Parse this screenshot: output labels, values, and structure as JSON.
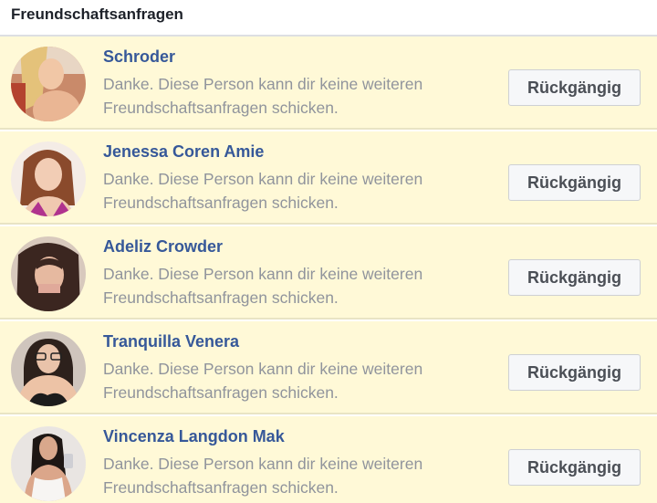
{
  "header": {
    "title": "Freundschaftsanfragen"
  },
  "requests": [
    {
      "name": "Schroder",
      "message": "Danke. Diese Person kann dir keine weiteren Freundschaftsanfragen schicken.",
      "button_label": "Rückgängig"
    },
    {
      "name": "Jenessa Coren Amie",
      "message": "Danke. Diese Person kann dir keine weiteren Freundschaftsanfragen schicken.",
      "button_label": "Rückgängig"
    },
    {
      "name": "Adeliz Crowder",
      "message": "Danke. Diese Person kann dir keine weiteren Freundschaftsanfragen schicken.",
      "button_label": "Rückgängig"
    },
    {
      "name": "Tranquilla Venera",
      "message": "Danke. Diese Person kann dir keine weiteren Freundschaftsanfragen schicken.",
      "button_label": "Rückgängig"
    },
    {
      "name": "Vincenza Langdon Mak",
      "message": "Danke. Diese Person kann dir keine weiteren Freundschaftsanfragen schicken.",
      "button_label": "Rückgängig"
    }
  ],
  "colors": {
    "row_background": "#fff9d7",
    "name_link": "#365899",
    "message_text": "#90949c"
  }
}
